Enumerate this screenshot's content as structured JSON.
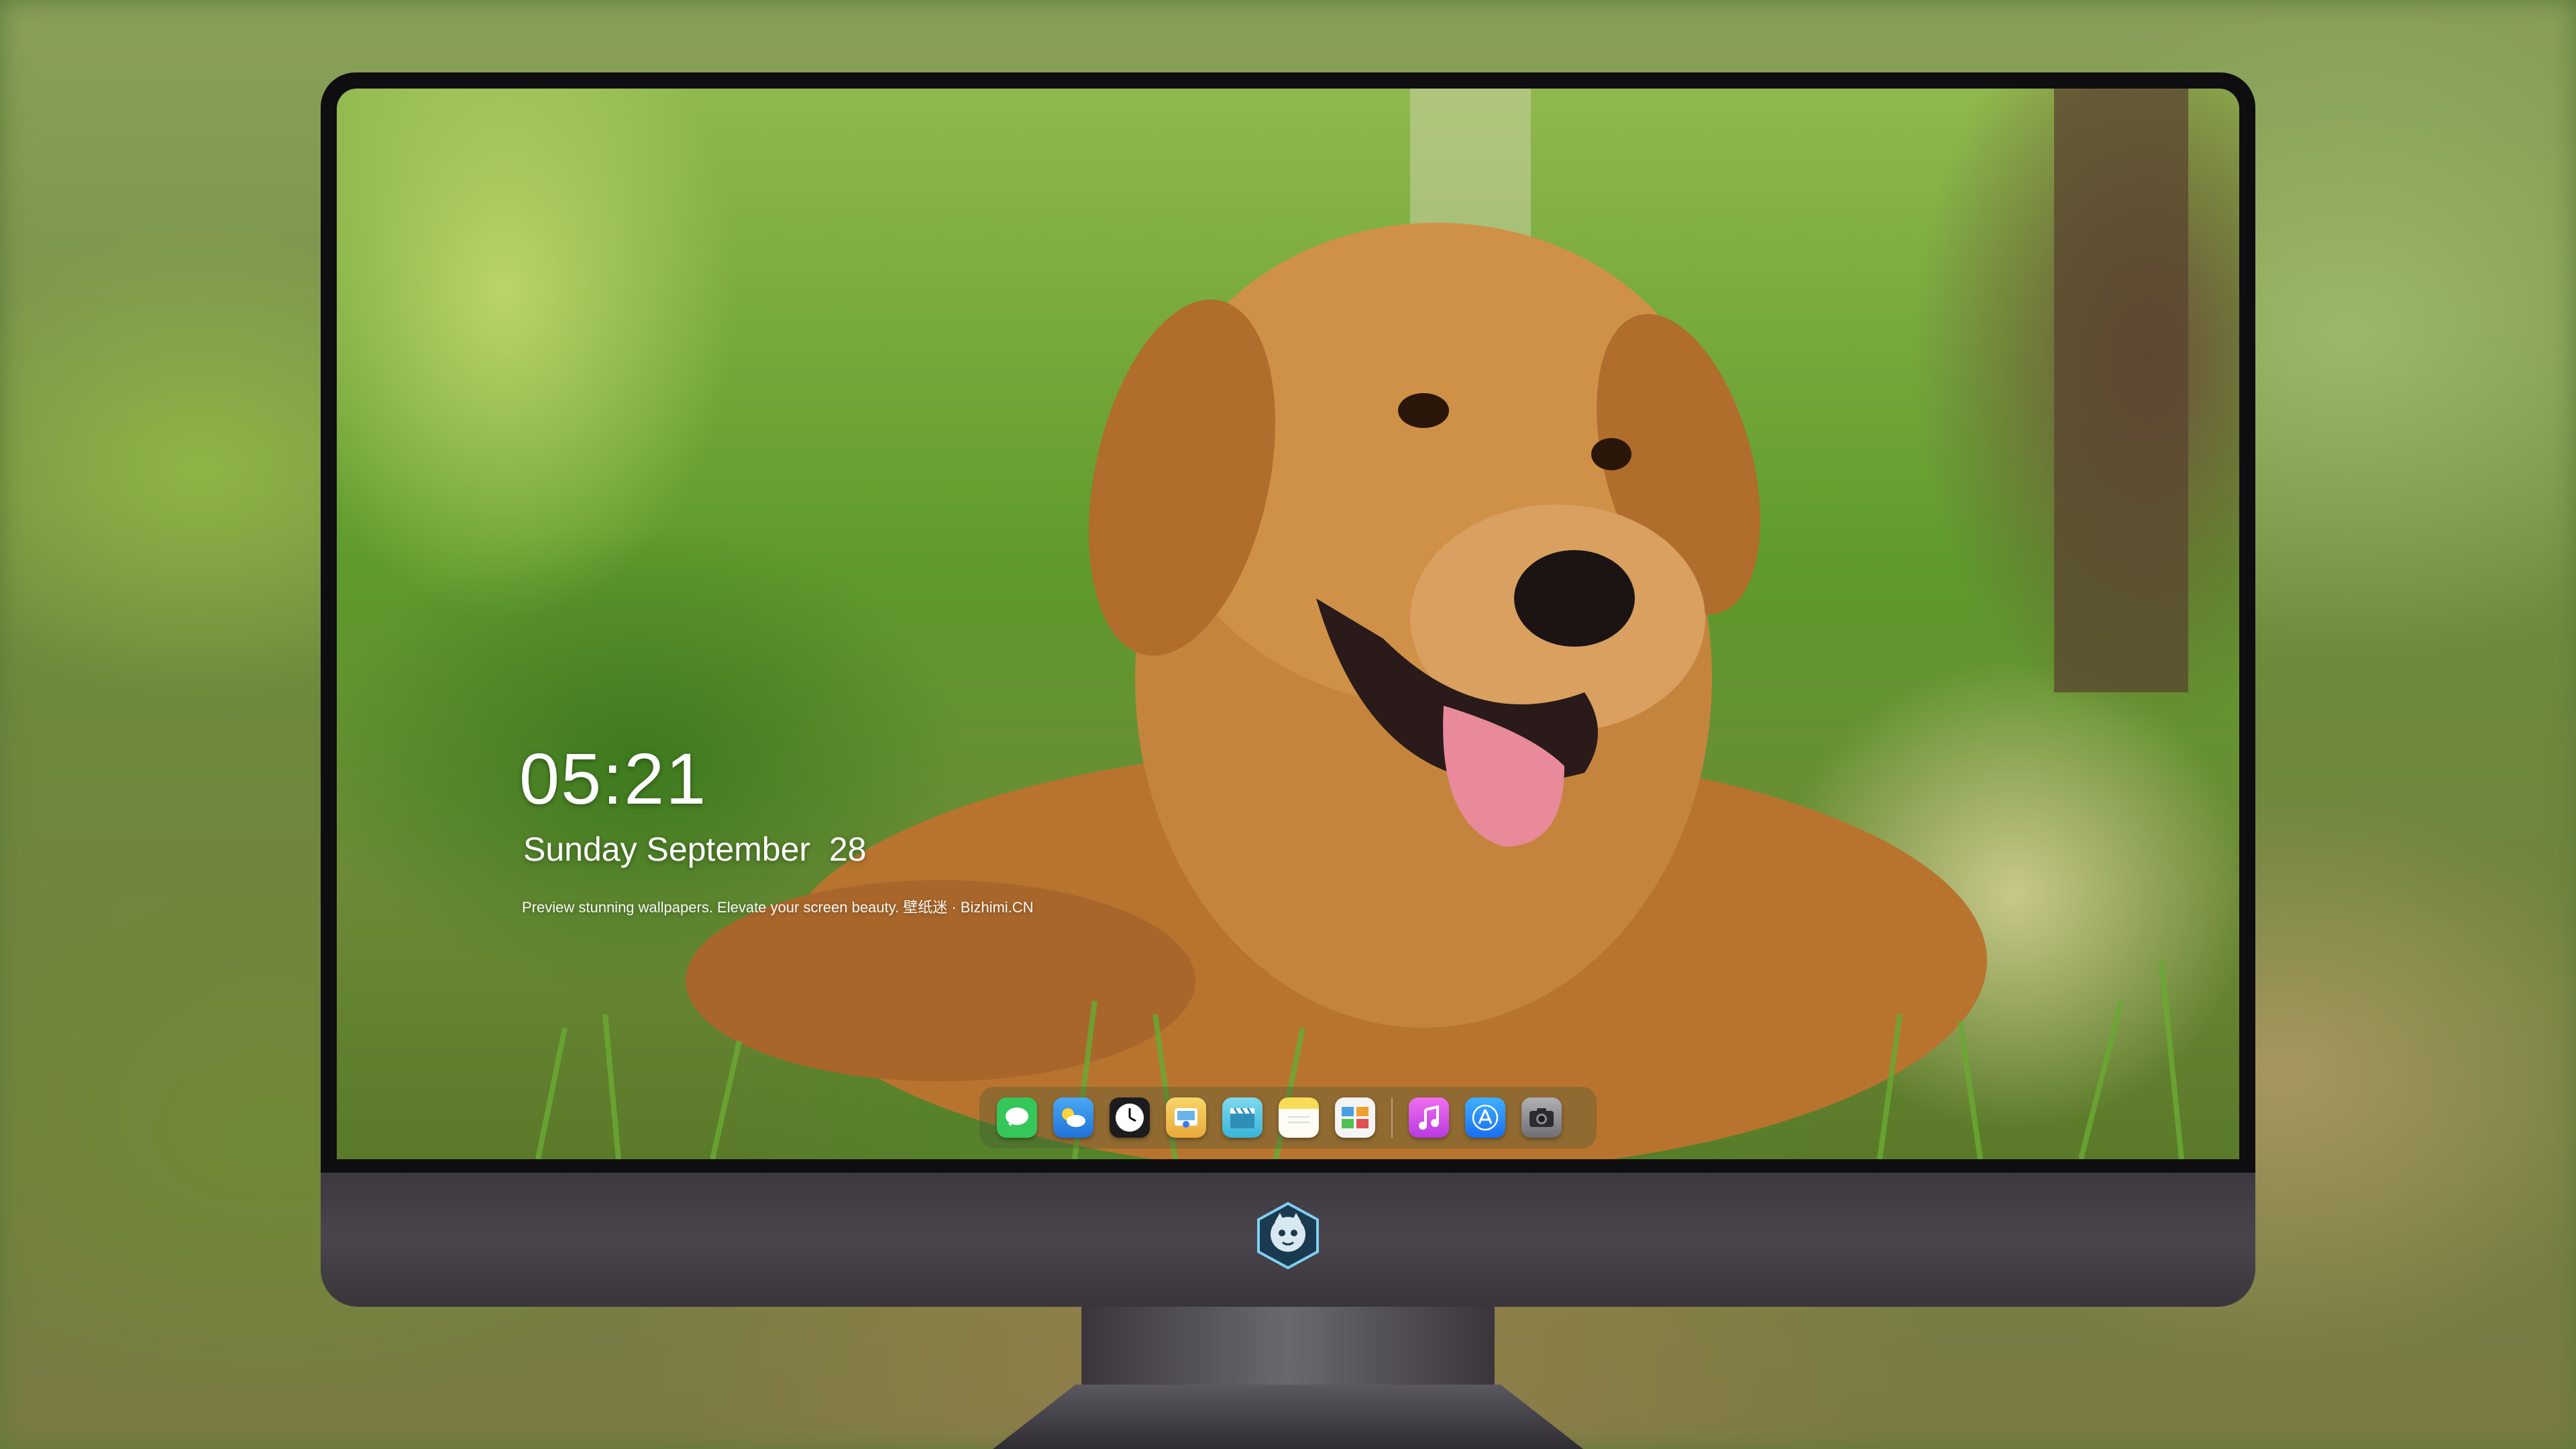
{
  "lock_screen": {
    "time": "05:21",
    "date": "Sunday September  28",
    "tagline": "Preview stunning wallpapers. Elevate your screen beauty. 壁纸迷 · Bizhimi.CN"
  },
  "dock": {
    "items": [
      {
        "name": "messages-icon",
        "color": "#35c759"
      },
      {
        "name": "weather-icon",
        "color": "#2f8fe8"
      },
      {
        "name": "clock-icon",
        "color": "#1c1c1e"
      },
      {
        "name": "preview-icon",
        "color": "#f0c24a"
      },
      {
        "name": "claquette-icon",
        "color": "#5ac8e0"
      },
      {
        "name": "notes-icon",
        "color": "#f5d94a"
      },
      {
        "name": "photo-gallery-icon",
        "color": "#4aa0e0"
      },
      {
        "name": "music-icon",
        "color": "#d14df0"
      },
      {
        "name": "app-store-icon",
        "color": "#1e90ff"
      },
      {
        "name": "camera-icon",
        "color": "#8e8e93"
      }
    ]
  },
  "colors": {
    "bezel": "#0e0d10",
    "chin": "#433e45",
    "dog": "#c4843e"
  }
}
